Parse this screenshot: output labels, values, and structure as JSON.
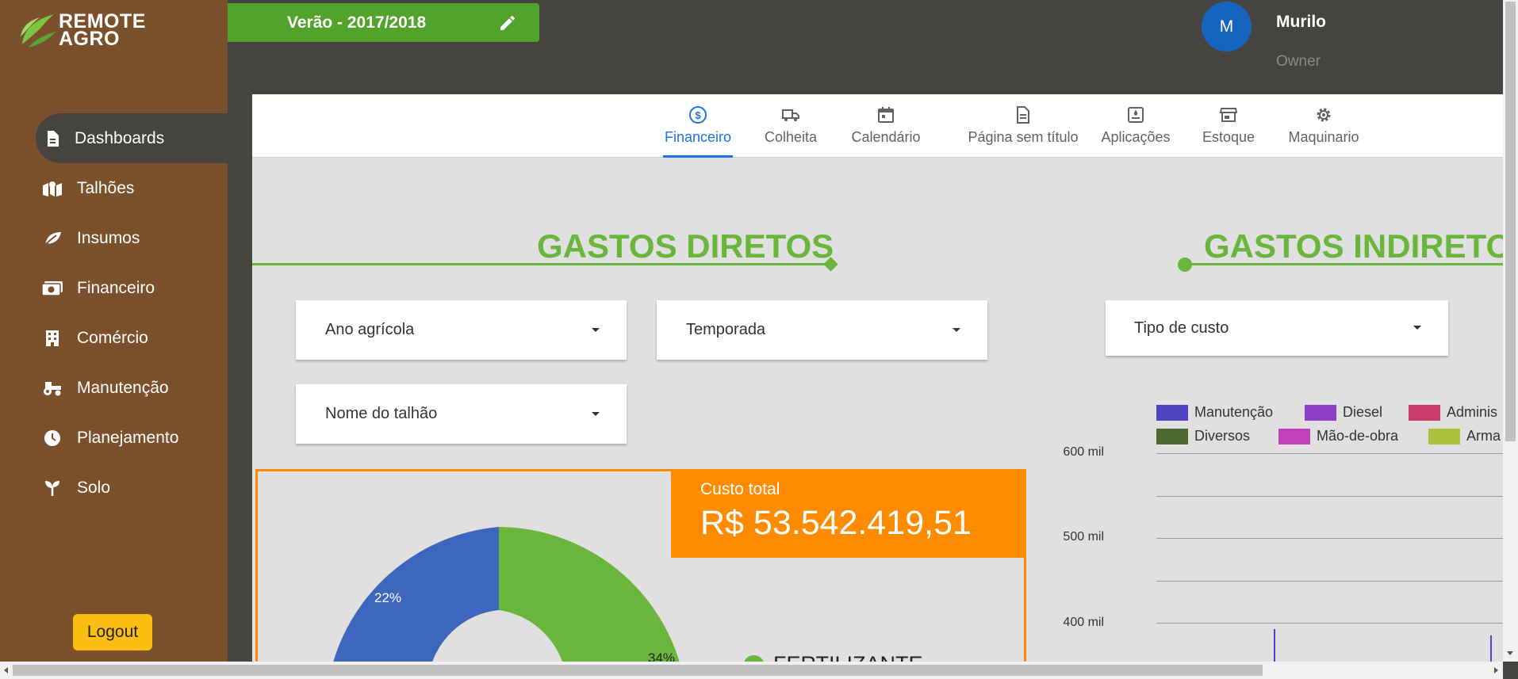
{
  "app": {
    "logo_line1": "REMOTE",
    "logo_line2": "AGRO"
  },
  "sidebar": {
    "items": [
      {
        "label": "Dashboards",
        "icon": "document-icon",
        "active": true
      },
      {
        "label": "Talhões",
        "icon": "map-icon"
      },
      {
        "label": "Insumos",
        "icon": "leaf-icon"
      },
      {
        "label": "Financeiro",
        "icon": "money-icon"
      },
      {
        "label": "Comércio",
        "icon": "building-icon"
      },
      {
        "label": "Manutenção",
        "icon": "tractor-icon"
      },
      {
        "label": "Planejamento",
        "icon": "clock-icon"
      },
      {
        "label": "Solo",
        "icon": "sprout-icon"
      }
    ],
    "logout_label": "Logout"
  },
  "season": {
    "label": "Verão - 2017/2018"
  },
  "user": {
    "initial": "M",
    "name": "Murilo",
    "role": "Owner"
  },
  "tabs": [
    {
      "label": "Financeiro",
      "icon": "dollar-circle-icon",
      "active": true
    },
    {
      "label": "Colheita",
      "icon": "truck-icon"
    },
    {
      "label": "Calendário",
      "icon": "calendar-icon"
    },
    {
      "label": "Página sem título",
      "icon": "page-icon"
    },
    {
      "label": "Aplicações",
      "icon": "application-icon"
    },
    {
      "label": "Estoque",
      "icon": "store-icon"
    },
    {
      "label": "Maquinario",
      "icon": "gear-icon"
    }
  ],
  "direct": {
    "heading": "GASTOS DIRETOS",
    "filter_ano": "Ano agrícola",
    "filter_temporada": "Temporada",
    "filter_talhao": "Nome do talhão",
    "cost_label": "Custo total",
    "cost_value": "R$ 53.542.419,51",
    "legend_first": "FERTILIZANTE",
    "slice_labels": {
      "blue": "22%",
      "green": "34%"
    },
    "colors": {
      "blue": "#3c67bd",
      "green": "#6ab63c",
      "orange": "#ff8c00"
    }
  },
  "indirect": {
    "heading": "GASTOS INDIRETOS",
    "filter_tipo": "Tipo de custo"
  },
  "chart_data": {
    "type": "bar",
    "series": [
      {
        "name": "Manutenção",
        "color": "#4f44c2"
      },
      {
        "name": "Diesel",
        "color": "#8c3fc4"
      },
      {
        "name": "Adminis",
        "color": "#c93b6c"
      },
      {
        "name": "Diversos",
        "color": "#4d6b31"
      },
      {
        "name": "Mão-de-obra",
        "color": "#c43fbb"
      },
      {
        "name": "Arma",
        "color": "#a9c13c"
      }
    ],
    "y_ticks": [
      "600 mil",
      "500 mil",
      "400 mil"
    ],
    "ylim": [
      400000,
      600000
    ],
    "grid": true
  }
}
